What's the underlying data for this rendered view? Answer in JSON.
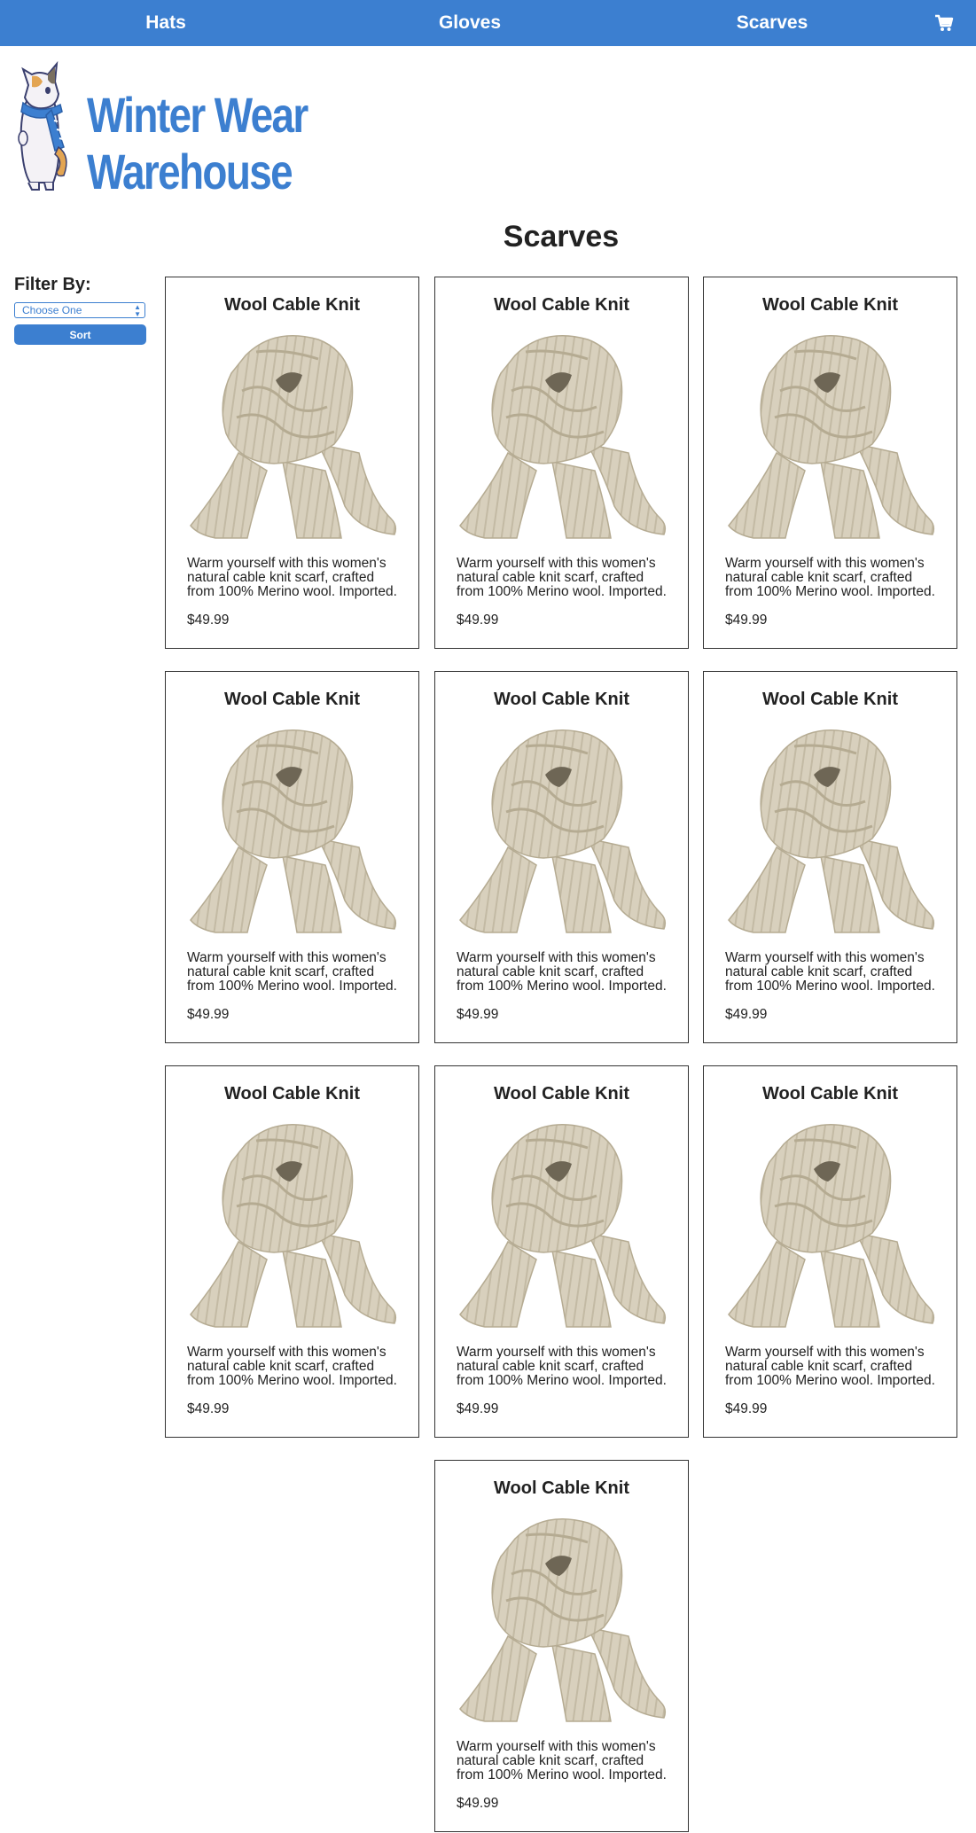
{
  "nav": {
    "items": [
      {
        "label": "Hats"
      },
      {
        "label": "Gloves"
      },
      {
        "label": "Scarves"
      }
    ],
    "cart_icon": "shopping-cart-icon"
  },
  "logo": {
    "line1": "Winter Wear",
    "line2": "Warehouse",
    "mascot_icon": "cat-mascot-icon"
  },
  "page": {
    "title": "Scarves"
  },
  "filter": {
    "label": "Filter By:",
    "select_value": "Choose One",
    "sort_label": "Sort"
  },
  "colors": {
    "brand_blue": "#3c7fd0",
    "scarf": "#d8d0bd"
  },
  "products": [
    {
      "name": "Wool Cable Knit",
      "description": "Warm yourself with this women's natural cable knit scarf, crafted from 100% Merino wool. Imported.",
      "price": "$49.99"
    },
    {
      "name": "Wool Cable Knit",
      "description": "Warm yourself with this women's natural cable knit scarf, crafted from 100% Merino wool. Imported.",
      "price": "$49.99"
    },
    {
      "name": "Wool Cable Knit",
      "description": "Warm yourself with this women's natural cable knit scarf, crafted from 100% Merino wool. Imported.",
      "price": "$49.99"
    },
    {
      "name": "Wool Cable Knit",
      "description": "Warm yourself with this women's natural cable knit scarf, crafted from 100% Merino wool. Imported.",
      "price": "$49.99"
    },
    {
      "name": "Wool Cable Knit",
      "description": "Warm yourself with this women's natural cable knit scarf, crafted from 100% Merino wool. Imported.",
      "price": "$49.99"
    },
    {
      "name": "Wool Cable Knit",
      "description": "Warm yourself with this women's natural cable knit scarf, crafted from 100% Merino wool. Imported.",
      "price": "$49.99"
    },
    {
      "name": "Wool Cable Knit",
      "description": "Warm yourself with this women's natural cable knit scarf, crafted from 100% Merino wool. Imported.",
      "price": "$49.99"
    },
    {
      "name": "Wool Cable Knit",
      "description": "Warm yourself with this women's natural cable knit scarf, crafted from 100% Merino wool. Imported.",
      "price": "$49.99"
    },
    {
      "name": "Wool Cable Knit",
      "description": "Warm yourself with this women's natural cable knit scarf, crafted from 100% Merino wool. Imported.",
      "price": "$49.99"
    },
    {
      "name": "Wool Cable Knit",
      "description": "Warm yourself with this women's natural cable knit scarf, crafted from 100% Merino wool. Imported.",
      "price": "$49.99"
    }
  ]
}
